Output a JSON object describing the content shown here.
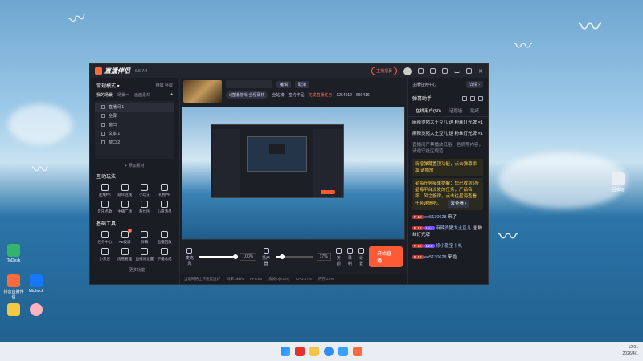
{
  "app": {
    "title": "直播伴侣",
    "version": "6.5.7.4",
    "start_live_pill": "主播招募",
    "pill_badge": "New"
  },
  "left_panel": {
    "mode_label": "常规模式 ▾",
    "mode_links": [
      "横屏",
      "竖屏"
    ],
    "scene_tabs": [
      "我的场景",
      "场景一",
      "画面素材"
    ],
    "sources": [
      {
        "label": "直播间 1",
        "selected": true
      },
      {
        "label": "全屏"
      },
      {
        "label": "窗口"
      },
      {
        "label": "文本 1"
      },
      {
        "label": "窗口 2"
      }
    ],
    "add_source": "+ 添加素材",
    "interact_title": "互动玩法",
    "interact_tools": [
      {
        "label": "连线PK",
        "icon": "pk-icon"
      },
      {
        "label": "观众连线",
        "icon": "link-icon"
      },
      {
        "label": "小玩法",
        "icon": "game-icon"
      },
      {
        "label": "礼物PK",
        "icon": "gift-icon"
      },
      {
        "label": "音乐点歌",
        "icon": "music-icon"
      },
      {
        "label": "主播广场",
        "icon": "square-icon"
      },
      {
        "label": "粉丝团",
        "icon": "fans-icon"
      },
      {
        "label": "心愿清单",
        "icon": "wish-icon"
      }
    ],
    "basic_title": "基础工具",
    "basic_tools": [
      {
        "label": "任务中心",
        "icon": "task-icon"
      },
      {
        "label": "AB投屏",
        "icon": "ab-icon",
        "badge": "8"
      },
      {
        "label": "弹幕",
        "icon": "danmu-icon"
      },
      {
        "label": "直播回放",
        "icon": "replay-icon"
      },
      {
        "label": "小黑屋",
        "icon": "blacklist-icon"
      },
      {
        "label": "房管管理",
        "icon": "admin-icon"
      },
      {
        "label": "直播间设置",
        "icon": "settings-icon"
      },
      {
        "label": "下播总结",
        "icon": "summary-icon"
      }
    ],
    "more_functions": "··· 更多功能"
  },
  "stream_info": {
    "edit_btn": "编辑",
    "cancel_btn": "取消",
    "tag_label": "#直播游戏·全程硬核",
    "total_link": "全站榜",
    "total_value": "",
    "fans_label": "1264012",
    "followers_label": "660416",
    "hint_text": "签约作品",
    "hint_red": "完成直播任务"
  },
  "controls": {
    "mic_label": "麦克风",
    "mic_volume": "100%",
    "speaker_label": "扬声器",
    "speaker_volume": "17%",
    "beauty_label": "美颜",
    "record_label": "录制",
    "settings_label": "设置",
    "start_btn": "开始直播"
  },
  "status_bar": {
    "hint": "当前网络上传速度良好",
    "bitrate": "码率:0kb/s",
    "fps": "FPS:60",
    "drop": "丢帧:0(0.0%)",
    "cpu": "CPU:27%",
    "mem": "内存:24%"
  },
  "right_panel": {
    "task_center": "主播任务中心",
    "task_btn": "详情 ›",
    "assistant_title": "弹幕助手",
    "tabs": [
      "在线用户(50)",
      "话题墙",
      "贴纸"
    ],
    "messages": [
      {
        "type": "normal",
        "text": "麻辣烫猪大土豆儿 送 粉丝灯光牌 ×1"
      },
      {
        "type": "normal",
        "text": "麻辣烫猪大土豆儿 送 粉丝灯光牌 ×1"
      },
      {
        "type": "sys",
        "text": "直播间严禁播放低俗、色情等内容，请遵守社区规范"
      },
      {
        "type": "hl",
        "text": "新增弹幕置顶功能，点击弹幕添加 请播放"
      },
      {
        "type": "hl",
        "text": "星海任务接单提醒：您已收到5条星海平台派发的任务，产品名称：风之旋律，点击往星海查看任务详情吧。"
      },
      {
        "type": "view",
        "text": "去查看 ›"
      },
      {
        "type": "user",
        "lvl": "R 12",
        "lvl2": "",
        "name": "ee5130628",
        "text": "来了"
      },
      {
        "type": "user",
        "lvl": "R 12",
        "lvl2": "LV.4",
        "name": "麻辣烫猪大土豆儿",
        "text": "送 粉丝灯光牌"
      },
      {
        "type": "user",
        "lvl": "R 12",
        "lvl2": "LV.4",
        "name": "麻辣烫猪大土豆儿",
        "text": "送 粉丝灯光牌"
      },
      {
        "type": "user",
        "lvl": "R 12",
        "lvl2": "LV.6",
        "name": "修小散空十礼",
        "text": "送 粉丝灯光牌"
      },
      {
        "type": "user",
        "lvl": "R 12",
        "lvl2": "",
        "name": "ee5130628",
        "text": "来啦"
      }
    ]
  },
  "desktop": {
    "icons": [
      {
        "label": "ToDesk",
        "color": "#33b36b"
      },
      {
        "label": "抖音直播伴侣",
        "color": "#ff6a3d"
      },
      {
        "label": "Mtcheck",
        "color": "#1677ff"
      },
      {
        "label": "",
        "color": "#f5c842"
      },
      {
        "label": "",
        "color": "#ffb3c1"
      }
    ],
    "recycle_label": "回收站"
  },
  "taskbar": {
    "time": "12:01",
    "date": "2026/4/1"
  }
}
